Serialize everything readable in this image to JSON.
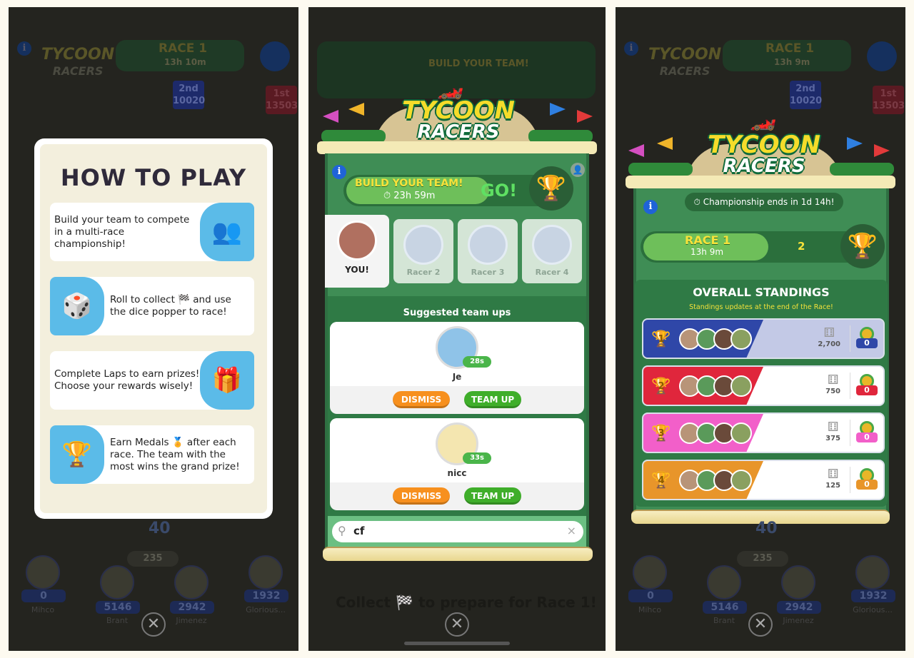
{
  "background_game": {
    "logo_line1": "TYCOON",
    "logo_line2": "RACERS",
    "race_title": "RACE 1",
    "race_timer_left": "13h 10m",
    "race_timer_right": "13h 9m",
    "build_team_dim": "BUILD YOUR TEAM!",
    "placements": [
      {
        "rank": "2nd",
        "score": "10020"
      },
      {
        "rank": "1st",
        "score": "13503"
      }
    ],
    "dice_count": "40",
    "coins": "235",
    "players": [
      {
        "name": "Mihco",
        "score": "0"
      },
      {
        "name": "Brant",
        "score": "5146"
      },
      {
        "name": "Jimenez",
        "score": "2942"
      },
      {
        "name": "Glorious...",
        "score": "1932"
      }
    ],
    "collect_text": "Collect 🏁 to prepare for Race 1!"
  },
  "how_to_play": {
    "title": "HOW TO PLAY",
    "rows": [
      {
        "text": "Build your team to compete in a multi-race championship!",
        "icon": "team-slots-icon"
      },
      {
        "text": "Roll to collect 🏁 and use the dice popper to race!",
        "icon": "dice-popper-icon"
      },
      {
        "text": "Complete Laps to earn prizes! Choose your rewards wisely!",
        "icon": "prize-box-icon"
      },
      {
        "text": "Earn Medals 🏅 after each race. The team with the most wins the grand prize!",
        "icon": "trophy-icon"
      }
    ]
  },
  "team_builder": {
    "logo_line1": "TYCOON",
    "logo_line2": "RACERS",
    "build_label": "BUILD YOUR TEAM!",
    "timer": "23h 59m",
    "go_label": "GO!",
    "slots": [
      "YOU!",
      "Racer 2",
      "Racer 3",
      "Racer 4"
    ],
    "suggested_title": "Suggested team ups",
    "suggestions": [
      {
        "name": "Je",
        "time": "28s"
      },
      {
        "name": "nicc",
        "time": "33s"
      }
    ],
    "dismiss_label": "DISMISS",
    "team_up_label": "TEAM UP",
    "search_value": "cf",
    "clear_label": "×"
  },
  "standings": {
    "logo_line1": "TYCOON",
    "logo_line2": "RACERS",
    "championship_text": "Championship ends in 1d 14h!",
    "race_title": "RACE 1",
    "race_timer": "13h 9m",
    "race_count": "2",
    "title": "OVERALL STANDINGS",
    "subtitle": "Standings updates at the end of the Race!",
    "teams": [
      {
        "rank": "1",
        "color": "#2f47a8",
        "prize": "2,700",
        "medals": "0"
      },
      {
        "rank": "2",
        "color": "#e0263c",
        "prize": "750",
        "medals": "0"
      },
      {
        "rank": "3",
        "color": "#f25fc9",
        "prize": "375",
        "medals": "0"
      },
      {
        "rank": "4",
        "color": "#e8952a",
        "prize": "125",
        "medals": "0"
      }
    ]
  }
}
